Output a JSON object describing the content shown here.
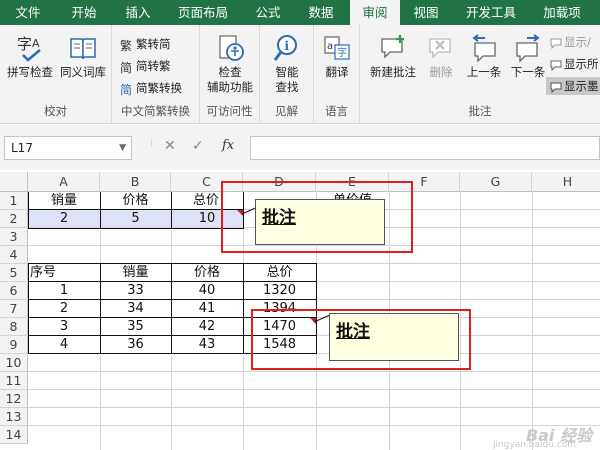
{
  "ribbon_tabs": [
    "文件",
    "开始",
    "插入",
    "页面布局",
    "公式",
    "数据",
    "审阅",
    "视图",
    "开发工具",
    "加载项"
  ],
  "active_tab": "审阅",
  "groups": {
    "proofing": {
      "label": "校对",
      "spell": "拼写检查",
      "thesaurus": "同义词库"
    },
    "chinese": {
      "label": "中文简繁转换",
      "t2s": "繁转简",
      "s2t": "简转繁",
      "convert": "简繁转换"
    },
    "access": {
      "label": "可访问性",
      "check_line1": "检查",
      "check_line2": "辅助功能"
    },
    "insights": {
      "label": "见解",
      "line1": "智能",
      "line2": "查找"
    },
    "language": {
      "label": "语言",
      "translate": "翻译"
    },
    "comments": {
      "label": "批注",
      "new": "新建批注",
      "delete": "删除",
      "prev": "上一条",
      "next": "下一条",
      "show_hide": "显示/",
      "show_all": "显示所",
      "show_ink": "显示墨"
    }
  },
  "formula_bar": {
    "name_box": "L17",
    "fx": "fx",
    "cancel": "✕",
    "enter": "✓",
    "formula": ""
  },
  "columns": [
    "A",
    "B",
    "C",
    "D",
    "E",
    "F",
    "G",
    "H"
  ],
  "rows": [
    "1",
    "2",
    "3",
    "4",
    "5",
    "6",
    "7",
    "8",
    "9",
    "10",
    "11",
    "12",
    "13",
    "14"
  ],
  "table1": {
    "headers": [
      "销量",
      "价格",
      "总价",
      "",
      "单价值"
    ],
    "row2": [
      "2",
      "5",
      "10"
    ]
  },
  "table2": {
    "headers": [
      "序号",
      "销量",
      "价格",
      "总价"
    ],
    "rows": [
      [
        "1",
        "33",
        "40",
        "1320"
      ],
      [
        "2",
        "34",
        "41",
        "1394"
      ],
      [
        "3",
        "35",
        "42",
        "1470"
      ],
      [
        "4",
        "36",
        "43",
        "1548"
      ]
    ]
  },
  "comments": [
    {
      "text": "批注"
    },
    {
      "text": "批注"
    }
  ],
  "watermark": {
    "brand": "Bai 经验",
    "url": "jingyan.baidu.com"
  },
  "colors": {
    "accent": "#217346",
    "selection": "#dde3f4",
    "comment_bg": "#ffffe1",
    "highlight_frame": "#e02020"
  }
}
